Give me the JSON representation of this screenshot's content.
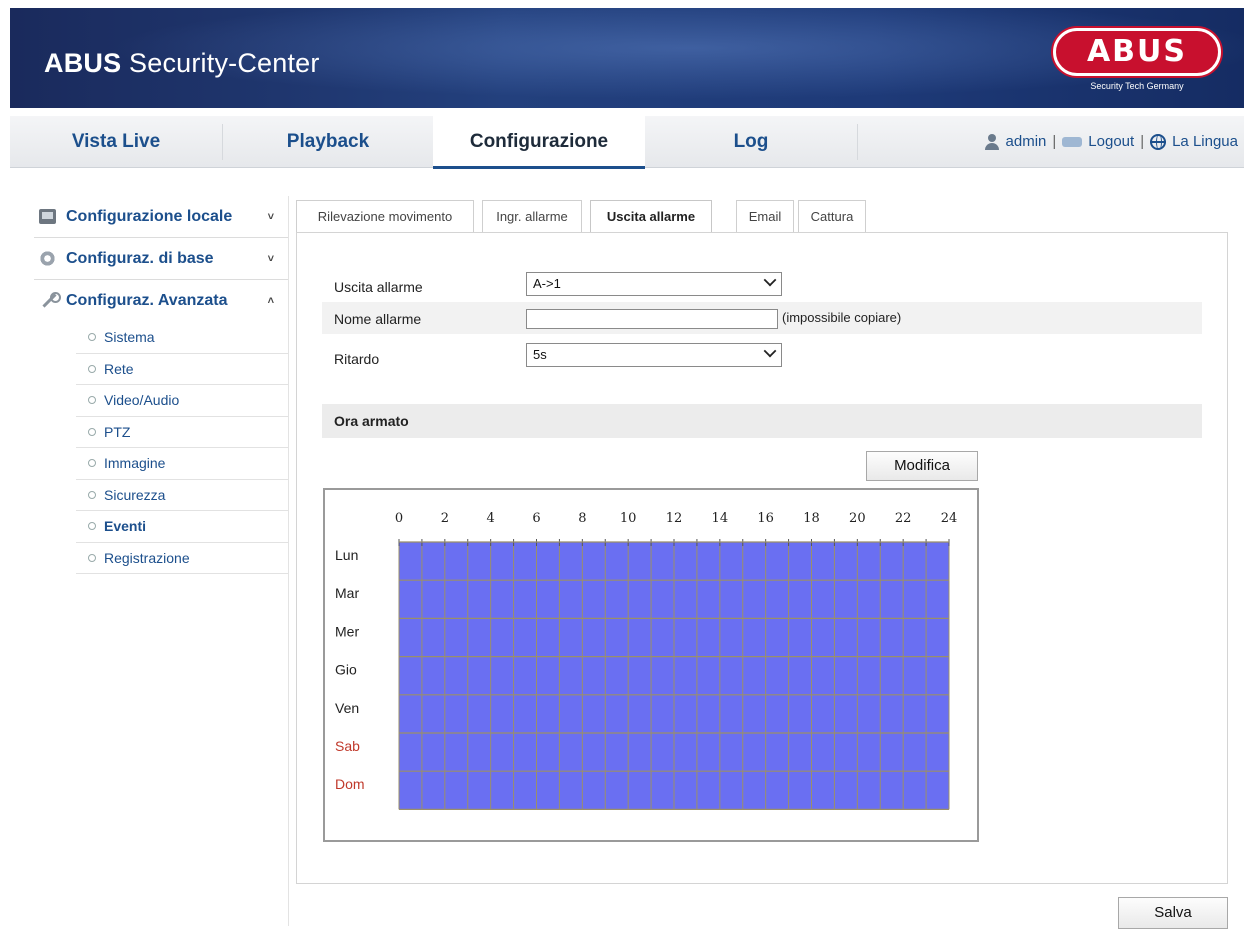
{
  "header": {
    "title_bold": "ABUS",
    "title_rest": " Security-Center",
    "logo_text": "ABUS",
    "logo_tagline": "Security Tech Germany"
  },
  "nav": {
    "tabs": [
      {
        "label": "Vista Live"
      },
      {
        "label": "Playback"
      },
      {
        "label": "Configurazione",
        "active": true
      },
      {
        "label": "Log"
      }
    ],
    "user": "admin",
    "logout": "Logout",
    "language": "La Lingua",
    "separator": "|"
  },
  "sidebar": {
    "sections": [
      {
        "label": "Configurazione locale",
        "chevron": "˅",
        "icon": "monitor-icon"
      },
      {
        "label": "Configuraz. di base",
        "chevron": "˅",
        "icon": "gear-icon"
      },
      {
        "label": "Configuraz. Avanzata",
        "chevron": "˄",
        "icon": "wrench-icon"
      }
    ],
    "items": [
      {
        "label": "Sistema"
      },
      {
        "label": "Rete"
      },
      {
        "label": "Video/Audio"
      },
      {
        "label": "PTZ"
      },
      {
        "label": "Immagine"
      },
      {
        "label": "Sicurezza"
      },
      {
        "label": "Eventi",
        "active": true
      },
      {
        "label": "Registrazione"
      }
    ]
  },
  "content_tabs": [
    {
      "label": "Rilevazione movimento"
    },
    {
      "label": "Ingr. allarme"
    },
    {
      "label": "Uscita allarme",
      "active": true
    },
    {
      "label": "Email"
    },
    {
      "label": "Cattura"
    }
  ],
  "form": {
    "alarm_output": {
      "label": "Uscita allarme",
      "value": "A->1"
    },
    "alarm_name": {
      "label": "Nome allarme",
      "value": "",
      "hint": "(impossibile copiare)"
    },
    "delay": {
      "label": "Ritardo",
      "value": "5s"
    }
  },
  "armed_section": {
    "label": "Ora armato"
  },
  "edit_button": "Modifica",
  "save_button": "Salva",
  "schedule": {
    "hour_labels": [
      "0",
      "2",
      "4",
      "6",
      "8",
      "10",
      "12",
      "14",
      "16",
      "18",
      "20",
      "22",
      "24"
    ],
    "days": [
      {
        "label": "Lun",
        "weekend": false
      },
      {
        "label": "Mar",
        "weekend": false
      },
      {
        "label": "Mer",
        "weekend": false
      },
      {
        "label": "Gio",
        "weekend": false
      },
      {
        "label": "Ven",
        "weekend": false
      },
      {
        "label": "Sab",
        "weekend": true
      },
      {
        "label": "Dom",
        "weekend": true
      }
    ],
    "armed_all_week": true,
    "colors": {
      "armed": "#6a6ff2",
      "grid": "#9a8f6a",
      "weekend_label": "#c0392b",
      "weekday_label": "#222222"
    }
  },
  "colors": {
    "link": "#1c4f8c",
    "banner": "#1e3a78",
    "logo_red": "#c8102e"
  }
}
